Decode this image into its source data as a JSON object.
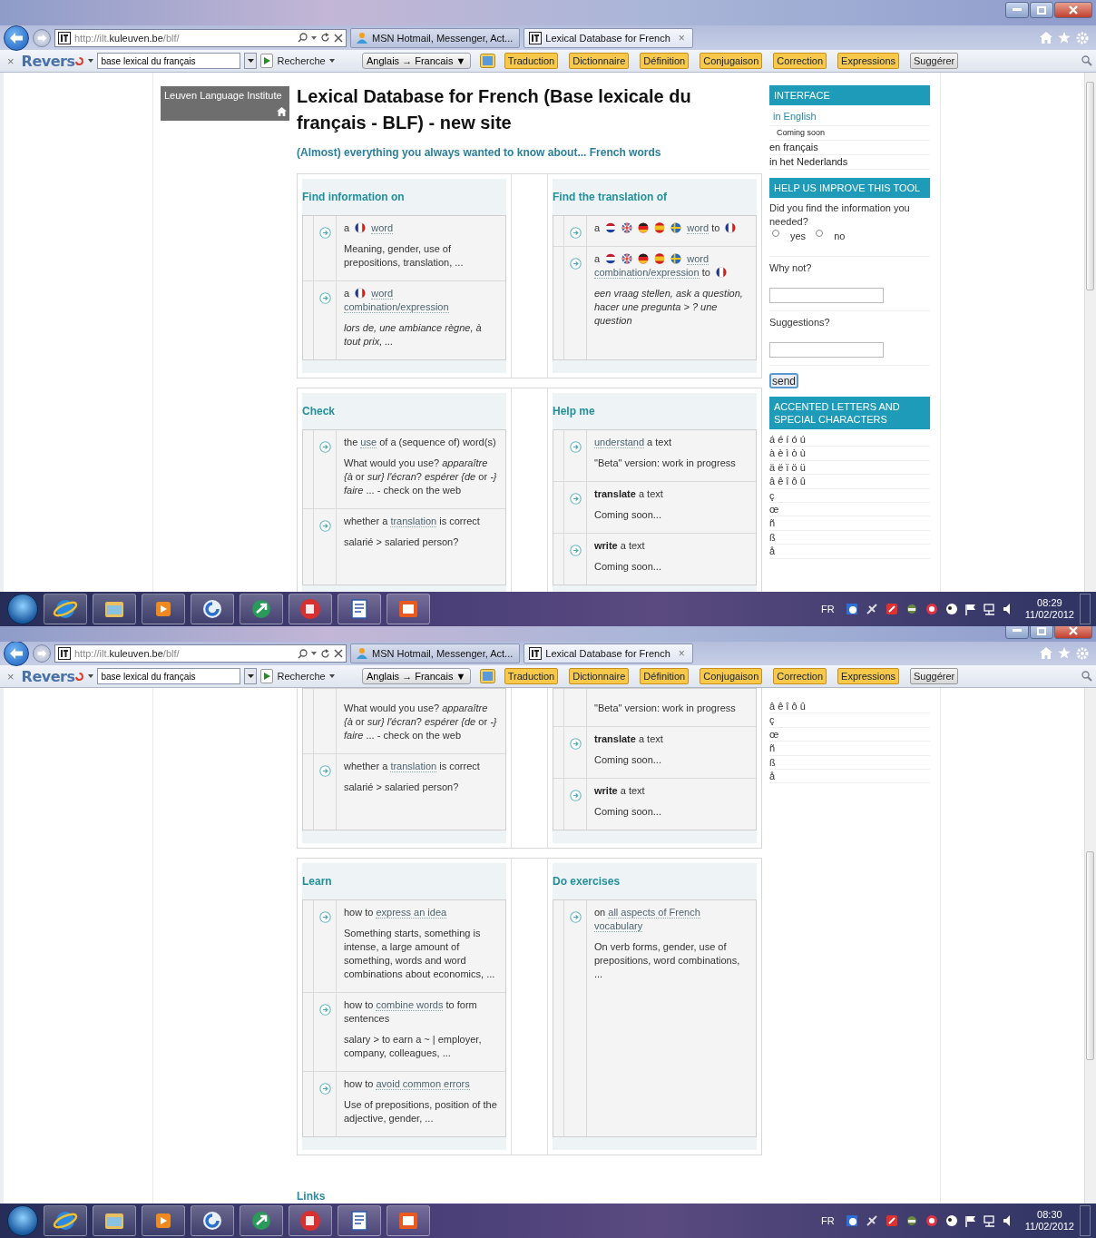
{
  "screens": [
    {
      "browser": {
        "address": "http://ilt.**kuleuven.be**/blf/",
        "tabs": [
          {
            "title": "MSN Hotmail, Messenger, Act...",
            "selected": false
          },
          {
            "title": "Lexical Database for French",
            "selected": true,
            "close": "×"
          }
        ],
        "toolbar": {
          "close": "×",
          "logo": "Revers",
          "search_value": "base lexical du français",
          "search_label": "Recherche",
          "language": "Anglais → Francais ▼",
          "buttons": [
            {
              "label": "Traduction",
              "kind": "highlight"
            },
            {
              "label": "Dictionnaire",
              "kind": "highlight"
            },
            {
              "label": "Définition",
              "kind": "highlight"
            },
            {
              "label": "Conjugaison",
              "kind": "highlight"
            },
            {
              "label": "Correction",
              "kind": "highlight"
            },
            {
              "label": "Expressions",
              "kind": "highlight"
            },
            {
              "label": "Suggérer",
              "kind": "plain"
            }
          ]
        }
      },
      "page": {
        "institute": "Leuven Language Institute",
        "title": "Lexical Database for French (Base lexicale du français - BLF) - new site",
        "subtitle": "(Almost) everything you always wanted to know about... French words",
        "rows": [
          [
            {
              "heading": "Find information on",
              "items": [
                {
                  "title": [
                    {
                      "kind": "text",
                      "text": "a"
                    },
                    {
                      "kind": "flag"
                    },
                    {
                      "kind": "link",
                      "text": "word"
                    }
                  ],
                  "description": "Meaning, gender, use of prepositions, translation, ..."
                },
                {
                  "title": [
                    {
                      "kind": "text",
                      "text": "a"
                    },
                    {
                      "kind": "flag"
                    },
                    {
                      "kind": "link",
                      "text": "word"
                    },
                    {
                      "kind": "link",
                      "text": "combination/expression"
                    }
                  ],
                  "example": "lors de, une ambiance règne, à tout prix, ..."
                }
              ]
            },
            {
              "heading": "Find the translation of",
              "items": [
                {
                  "title": [
                    {
                      "kind": "text",
                      "text": "a"
                    },
                    {
                      "kind": "flags"
                    },
                    {
                      "kind": "link",
                      "text": "word"
                    },
                    {
                      "kind": "text",
                      "text": "to"
                    },
                    {
                      "kind": "flag"
                    }
                  ]
                },
                {
                  "title": [
                    {
                      "kind": "text",
                      "text": "a"
                    },
                    {
                      "kind": "flags"
                    },
                    {
                      "kind": "link",
                      "text": "word"
                    },
                    {
                      "kind": "link",
                      "text": "combination/expression"
                    },
                    {
                      "kind": "text",
                      "text": "to"
                    },
                    {
                      "kind": "flag"
                    }
                  ],
                  "example": "een vraag stellen, ask a question, hacer une pregunta > ? une question"
                }
              ]
            }
          ],
          [
            {
              "heading": "Check",
              "items": [
                {
                  "title": [
                    {
                      "kind": "text",
                      "text": "the"
                    },
                    {
                      "kind": "link",
                      "text": "use"
                    },
                    {
                      "kind": "text",
                      "text": "of a (sequence of) word(s)"
                    }
                  ],
                  "description": "What would you use? *apparaître {à* or *sur} l'écran*? *espérer {de* or *-}* *faire* ... - check on the web"
                },
                {
                  "title": [
                    {
                      "kind": "text",
                      "text": "whether a"
                    },
                    {
                      "kind": "link",
                      "text": "translation"
                    },
                    {
                      "kind": "text",
                      "text": "is correct"
                    }
                  ],
                  "description": "salarié > salaried person?"
                }
              ]
            },
            {
              "heading": "Help me",
              "items": [
                {
                  "title": [
                    {
                      "kind": "link",
                      "text": "understand"
                    },
                    {
                      "kind": "text",
                      "text": "a text"
                    }
                  ],
                  "description": "\"Beta\" version: work in progress"
                },
                {
                  "title": [
                    {
                      "kind": "bold",
                      "text": "translate"
                    },
                    {
                      "kind": "text",
                      "text": "a text"
                    }
                  ],
                  "description": "Coming soon..."
                },
                {
                  "title": [
                    {
                      "kind": "bold",
                      "text": "write"
                    },
                    {
                      "kind": "text",
                      "text": "a text"
                    }
                  ],
                  "description": "Coming soon..."
                }
              ]
            }
          ]
        ],
        "sidebar": [
          {
            "kind": "interface",
            "heading": "INTERFACE",
            "options": [
              {
                "kind": "link",
                "label": "in English"
              },
              {
                "kind": "note",
                "label": "Coming soon"
              },
              {
                "kind": "plain",
                "label": "en français"
              },
              {
                "kind": "plain",
                "label": "in het Nederlands"
              }
            ]
          },
          {
            "kind": "feedback",
            "heading": "HELP US IMPROVE THIS TOOL",
            "question": "Did you find the information you needed?",
            "radios": [
              {
                "label": "yes",
                "checked": false
              },
              {
                "label": "no",
                "checked": false
              }
            ],
            "fields": [
              {
                "label": "Why not?"
              },
              {
                "label": "Suggestions?"
              }
            ],
            "button": "send"
          },
          {
            "kind": "characters",
            "heading": "ACCENTED LETTERS AND SPECIAL CHARACTERS",
            "rows": [
              "á é í ó ú",
              "à è ì ò ù",
              "ä ë ï ö ü",
              "â ê î ô û",
              "ç",
              "œ",
              "ñ",
              "ß",
              "å"
            ]
          }
        ]
      },
      "taskbar": {
        "language": "FR",
        "time": "08:29",
        "date": "11/02/2012"
      }
    },
    {
      "browser": {
        "address": "http://ilt.**kuleuven.be**/blf/",
        "tabs": [
          {
            "title": "MSN Hotmail, Messenger, Act...",
            "selected": false
          },
          {
            "title": "Lexical Database for French",
            "selected": true,
            "close": "×"
          }
        ],
        "toolbar": {
          "close": "×",
          "logo": "Revers",
          "search_value": "base lexical du français",
          "search_label": "Recherche",
          "language": "Anglais → Francais ▼",
          "buttons": [
            {
              "label": "Traduction",
              "kind": "highlight"
            },
            {
              "label": "Dictionnaire",
              "kind": "highlight"
            },
            {
              "label": "Définition",
              "kind": "highlight"
            },
            {
              "label": "Conjugaison",
              "kind": "highlight"
            },
            {
              "label": "Correction",
              "kind": "highlight"
            },
            {
              "label": "Expressions",
              "kind": "highlight"
            },
            {
              "label": "Suggérer",
              "kind": "plain"
            }
          ]
        }
      },
      "page": {
        "rows": [
          [
            {
              "items": [
                {
                  "description": "What would you use? *apparaître {à* or *sur} l'écran*? *espérer {de* or *-}* *faire* ... - check on the web"
                },
                {
                  "title": [
                    {
                      "kind": "text",
                      "text": "whether a"
                    },
                    {
                      "kind": "link",
                      "text": "translation"
                    },
                    {
                      "kind": "text",
                      "text": "is correct"
                    }
                  ],
                  "description": "salarié > salaried person?"
                }
              ]
            },
            {
              "items": [
                {
                  "description": "\"Beta\" version: work in progress"
                },
                {
                  "title": [
                    {
                      "kind": "bold",
                      "text": "translate"
                    },
                    {
                      "kind": "text",
                      "text": "a text"
                    }
                  ],
                  "description": "Coming soon..."
                },
                {
                  "title": [
                    {
                      "kind": "bold",
                      "text": "write"
                    },
                    {
                      "kind": "text",
                      "text": "a text"
                    }
                  ],
                  "description": "Coming soon..."
                }
              ]
            }
          ],
          [
            {
              "heading": "Learn",
              "items": [
                {
                  "title": [
                    {
                      "kind": "text",
                      "text": "how to"
                    },
                    {
                      "kind": "link",
                      "text": "express an idea"
                    }
                  ],
                  "description": "Something starts, something is intense, a large amount of something, words and word combinations about economics, ..."
                },
                {
                  "title": [
                    {
                      "kind": "text",
                      "text": "how to"
                    },
                    {
                      "kind": "link",
                      "text": "combine words"
                    },
                    {
                      "kind": "text",
                      "text": "to form sentences"
                    }
                  ],
                  "description": "salary > to earn a ~ | employer, company, colleagues, ..."
                },
                {
                  "title": [
                    {
                      "kind": "text",
                      "text": "how to"
                    },
                    {
                      "kind": "link",
                      "text": "avoid common errors"
                    }
                  ],
                  "description": "Use of prepositions, position of the adjective, gender, ..."
                }
              ]
            },
            {
              "heading": "Do exercises",
              "items": [
                {
                  "title": [
                    {
                      "kind": "text",
                      "text": "on"
                    },
                    {
                      "kind": "link",
                      "text": "all aspects of French"
                    },
                    {
                      "kind": "link",
                      "text": "vocabulary"
                    }
                  ],
                  "description": "On verb forms, gender, use of prepositions, word combinations, ..."
                }
              ]
            }
          ]
        ],
        "links_heading": "Links",
        "sidebar": [
          {
            "kind": "characters",
            "rows": [
              "â ê î ô û",
              "ç",
              "œ",
              "ñ",
              "ß",
              "å"
            ]
          }
        ]
      },
      "taskbar": {
        "language": "FR",
        "time": "08:30",
        "date": "11/02/2012"
      }
    }
  ]
}
